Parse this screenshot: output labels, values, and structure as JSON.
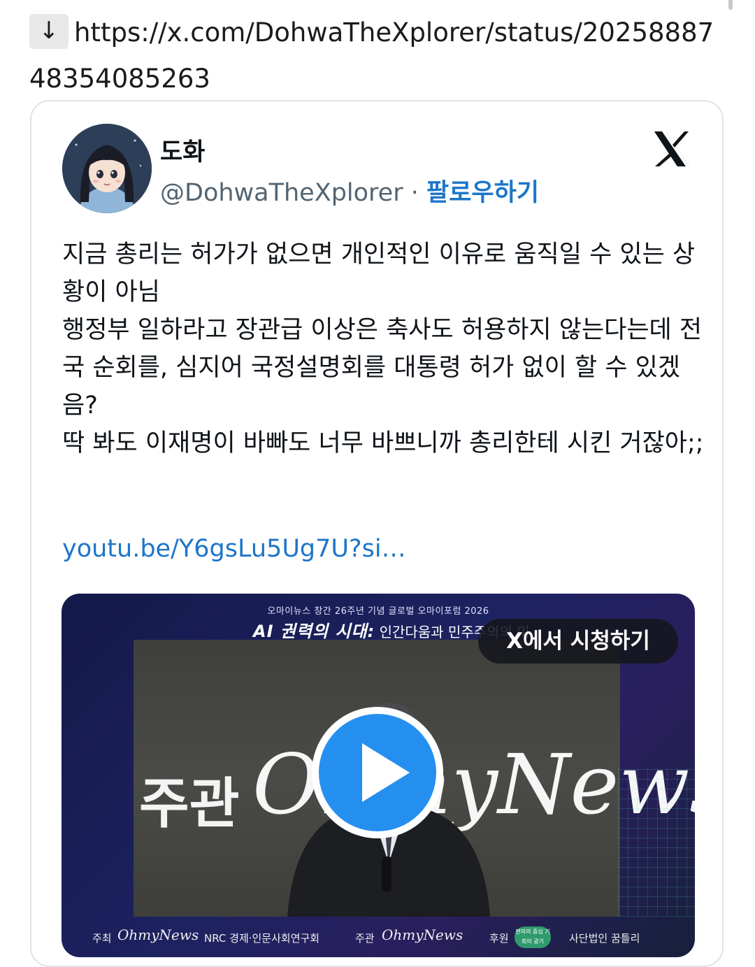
{
  "url": {
    "text": "https://x.com/DohwaTheXplorer/status/2025888748354085263",
    "icon": "down-arrow-icon",
    "icon_glyph": "↓"
  },
  "tweet": {
    "display_name": "도화",
    "handle": "@DohwaTheXplorer",
    "separator": "·",
    "follow_label": "팔로우하기",
    "text": "지금 총리는 허가가 없으면 개인적인 이유로 움직일 수 있는 상황이 아님\n행정부 일하라고 장관급 이상은 축사도 허용하지 않는다는데 전국 순회를, 심지어 국정설명회를 대통령 허가 없이 할 수 있겠음?\n딱 봐도 이재명이 바빠도 너무 바쁘니까 총리한테 시킨 거잖아;;",
    "link": "youtu.be/Y6gsLu5Ug7U?si…",
    "accent_color": "#1d75c9"
  },
  "media": {
    "watch_label": "X에서 시청하기",
    "banner_top": "오마이뉴스 창간 26주년 기념  글로벌 오마이포럼 2026",
    "banner_title_bold": "AI 권력의 시대:",
    "banner_title_rest": " 인간다움과 민주주의의 미",
    "stage_left": "주관",
    "stage_logo": "OhmyNews",
    "footer": {
      "host_label": "주최",
      "host_name": "OhmyNews",
      "nrc": "NRC 경제·인문사회연구회",
      "organizer_label": "주관",
      "organizer_name": "OhmyNews",
      "sponsor_label": "후원",
      "sponsor_badge": "편의의 중심 기회의 광기",
      "partner": "사단법인 꿈틀리"
    }
  }
}
